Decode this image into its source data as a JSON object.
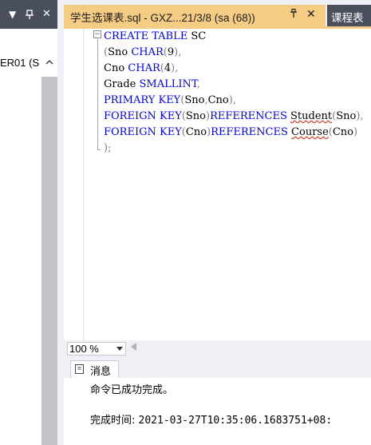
{
  "left_panel": {
    "dropdown_glyph": "▼",
    "pin_glyph": "一",
    "pin_char": "ᵼ",
    "close_glyph": "✕",
    "tree_item_label": "ER01 (S",
    "scroll_up_glyph": "^"
  },
  "tabs": [
    {
      "label": "学生选课表.sql - GXZ...21/3/8 (sa (68))",
      "pin": "ᵼ",
      "close": "✕",
      "active": true
    },
    {
      "label": "课程表",
      "active": false
    }
  ],
  "editor": {
    "lines": [
      "CREATE TABLE SC",
      "(Sno CHAR(9),",
      "Cno CHAR(4),",
      "Grade SMALLINT,",
      "PRIMARY KEY(Sno,Cno),",
      "FOREIGN KEY(Sno)REFERENCES Student(Sno),",
      "FOREIGN KEY(Cno)REFERENCES Course(Cno)",
      ");"
    ],
    "colors": {
      "keyword": "#0000ff",
      "function": "#ff00ff",
      "punctuation": "#808080",
      "squiggle": "#e51400"
    }
  },
  "zoom": {
    "value": "100 %",
    "caret": "▾"
  },
  "results": {
    "tab_label": "消息",
    "message": "命令已成功完成。",
    "time_label": "完成时间: ",
    "time_value": "2021-03-27T10:35:06.1683751+08:"
  },
  "theme": {
    "accent_tab": "#f5cc84",
    "dark_header": "#4a4f5e"
  }
}
